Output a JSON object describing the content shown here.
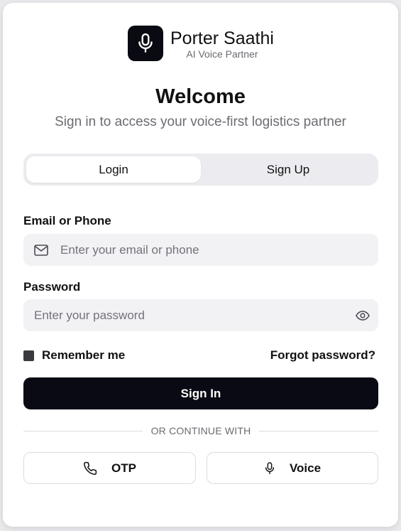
{
  "brand": {
    "name": "Porter Saathi",
    "tagline": "AI Voice Partner"
  },
  "header": {
    "title": "Welcome",
    "subtitle": "Sign in to access your voice-first logistics partner"
  },
  "tabs": [
    {
      "label": "Login",
      "active": true
    },
    {
      "label": "Sign Up",
      "active": false
    }
  ],
  "form": {
    "email": {
      "label": "Email or Phone",
      "placeholder": "Enter your email or phone",
      "value": ""
    },
    "password": {
      "label": "Password",
      "placeholder": "Enter your password",
      "value": ""
    },
    "remember_label": "Remember me",
    "remember_checked": true,
    "forgot_label": "Forgot password?",
    "submit_label": "Sign In"
  },
  "divider_text": "OR CONTINUE WITH",
  "alternatives": [
    {
      "label": "OTP",
      "icon": "phone-icon"
    },
    {
      "label": "Voice",
      "icon": "microphone-icon"
    }
  ],
  "colors": {
    "primary": "#0a0a14",
    "tab_track": "#ececf0",
    "input_bg": "#f2f2f5",
    "muted_text": "#6b6b73"
  }
}
